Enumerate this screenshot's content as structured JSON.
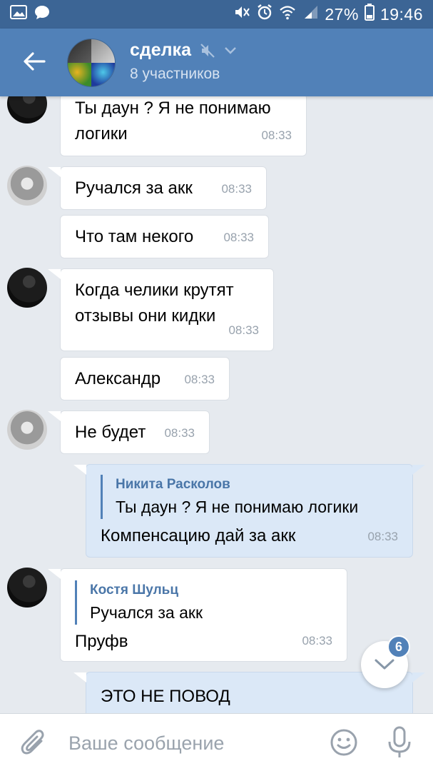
{
  "status_bar": {
    "battery": "27%",
    "time": "19:46",
    "icons": [
      "image-icon",
      "chat-icon",
      "mute-icon",
      "alarm-icon",
      "wifi-icon",
      "signal-icon",
      "battery-icon"
    ]
  },
  "header": {
    "title": "сделка",
    "subtitle": "8 участников",
    "icons": [
      "back-arrow-icon",
      "muted-speaker-icon",
      "chevron-down-icon"
    ]
  },
  "messages": [
    {
      "text": "Ты даун ? Я не понимаю логики",
      "time": "08:33",
      "direction": "in"
    },
    {
      "text": "Ручался за акк",
      "time": "08:33",
      "direction": "in"
    },
    {
      "text": "Что там некого",
      "time": "08:33",
      "direction": "in"
    },
    {
      "text": "Когда челики крутят отзывы они кидки",
      "time": "08:33",
      "direction": "in"
    },
    {
      "text": "Александр",
      "time": "08:33",
      "direction": "in"
    },
    {
      "text": "Не будет",
      "time": "08:33",
      "direction": "in"
    },
    {
      "reply_name": "Никита Расколов",
      "reply_text": "Ты даун ? Я не понимаю логики",
      "text": "Компенсацию дай за акк",
      "time": "08:33",
      "direction": "out"
    },
    {
      "reply_name": "Костя Шульц",
      "reply_text": "Ручался за акк",
      "text": "Пруфв",
      "time": "08:33",
      "direction": "in"
    },
    {
      "text": "ЭТО НЕ ПОВОД",
      "direction": "out"
    }
  ],
  "scroll_down": {
    "badge": "6"
  },
  "composer": {
    "placeholder": "Ваше сообщение"
  },
  "colors": {
    "header": "#5181b8",
    "status_bar": "#3c6595",
    "background": "#e6eaef",
    "outgoing_bubble": "#dbe8f7"
  }
}
